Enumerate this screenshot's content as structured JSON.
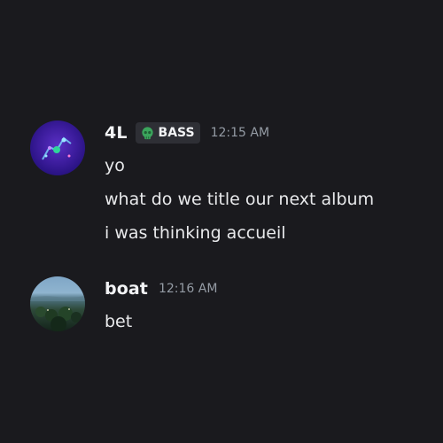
{
  "messages": [
    {
      "author": "4L",
      "role": {
        "label": "BASS",
        "icon": "green-skull-icon",
        "color": "#3ba55c"
      },
      "timestamp": "12:15 AM",
      "lines": [
        "yo",
        "what do we title our next album",
        "i was thinking accueil"
      ]
    },
    {
      "author": "boat",
      "timestamp": "12:16 AM",
      "lines": [
        "bet"
      ]
    }
  ],
  "colors": {
    "background": "#1a1a1e",
    "username": "#f2f3f5",
    "message_text": "#e8e9eb",
    "timestamp": "#949ba4",
    "role_tag_bg": "#2e2f35"
  }
}
